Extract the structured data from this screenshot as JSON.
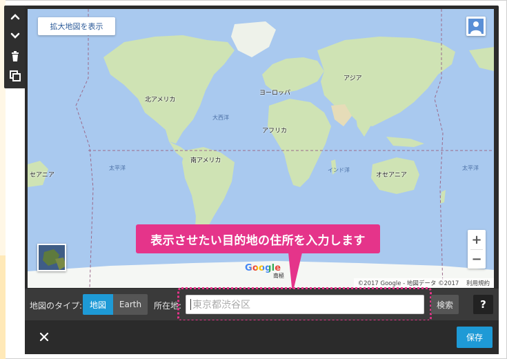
{
  "toolbar": {
    "items": [
      {
        "icon": "chevron-up-icon"
      },
      {
        "icon": "chevron-down-icon"
      },
      {
        "icon": "trash-icon"
      },
      {
        "icon": "copy-icon"
      }
    ]
  },
  "map": {
    "expand_label": "拡大地図を表示",
    "continents": {
      "north_america": "北アメリカ",
      "south_america": "南アメリカ",
      "europe": "ヨーロッパ",
      "asia": "アジア",
      "africa": "アフリカ",
      "oceania_left": "セアニア",
      "oceania_right": "オセアニア"
    },
    "oceans": {
      "atlantic": "大西洋",
      "pacific_left": "太平洋",
      "pacific_right": "太平洋",
      "indian": "インド洋"
    },
    "google_logo": "Google",
    "pole_label": "南極",
    "attribution": "©2017 Google - 地図データ ©2017",
    "terms": "利用規約",
    "zoom_in": "+",
    "zoom_out": "−"
  },
  "callout": {
    "text": "表示させたい目的地の住所を入力します"
  },
  "controls": {
    "map_type_label": "地図のタイプ:",
    "type_map": "地図",
    "type_earth": "Earth",
    "location_label": "所在地:",
    "address_placeholder": "東京都渋谷区",
    "search_label": "検索",
    "help_label": "?"
  },
  "footer": {
    "close_label": "✕",
    "save_label": "保存"
  },
  "colors": {
    "accent_blue": "#1e9ad6",
    "callout_pink": "#e5348a",
    "ocean": "#a9c9ef",
    "land": "#cfe3b4",
    "panel_dark": "#2b2b2b"
  }
}
